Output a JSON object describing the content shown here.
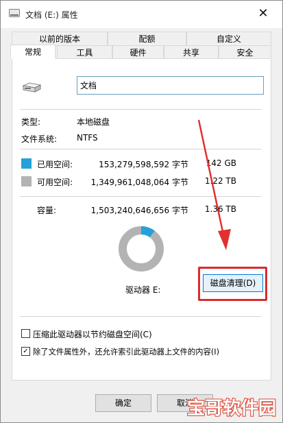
{
  "window": {
    "title": "文档 (E:) 属性",
    "close_glyph": "✕"
  },
  "tabs_row1": [
    {
      "label": "以前的版本"
    },
    {
      "label": "配额"
    },
    {
      "label": "自定义"
    }
  ],
  "tabs_row2": [
    {
      "label": "常规",
      "active": true
    },
    {
      "label": "工具"
    },
    {
      "label": "硬件"
    },
    {
      "label": "共享"
    },
    {
      "label": "安全"
    }
  ],
  "general": {
    "drive_name": "文档",
    "type_label": "类型:",
    "type_value": "本地磁盘",
    "fs_label": "文件系统:",
    "fs_value": "NTFS",
    "used": {
      "label": "已用空间:",
      "bytes": "153,279,598,592 字节",
      "size": "142 GB",
      "color": "#26a0da"
    },
    "free": {
      "label": "可用空间:",
      "bytes": "1,349,961,048,064 字节",
      "size": "1.22 TB",
      "color": "#b3b3b3"
    },
    "capacity": {
      "label": "容量:",
      "bytes": "1,503,240,646,656 字节",
      "size": "1.36 TB"
    },
    "used_fraction": 0.102,
    "drive_label": "驱动器 E:",
    "cleanup_button": "磁盘清理(D)"
  },
  "options": {
    "compress_label": "压缩此驱动器以节约磁盘空间(C)",
    "compress_checked": false,
    "index_label": "除了文件属性外，还允许索引此驱动器上文件的内容(I)",
    "index_checked": true,
    "check_glyph": "✓"
  },
  "buttons": {
    "ok": "确定",
    "cancel": "取消"
  },
  "annotation": {
    "arrow_color": "#e0312f",
    "highlight_color": "#d92b2b"
  },
  "watermark": {
    "text": "宝哥软件园",
    "color": "#d94a3a"
  }
}
